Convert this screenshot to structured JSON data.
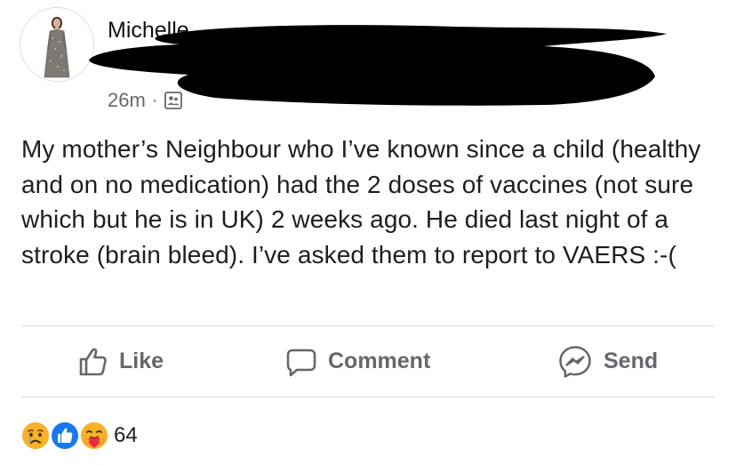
{
  "post": {
    "author_name": "Michelle",
    "timestamp": "26m",
    "separator": "·",
    "audience_icon": "friends-icon",
    "text": "My mother’s Neighbour who I’ve known since a child (healthy and on no medication) had the 2 doses of vaccines (not sure which but he is in UK) 2 weeks ago. He died last night of a stroke (brain bleed). I’ve asked them to report to VAERS :-("
  },
  "actions": {
    "like_label": "Like",
    "comment_label": "Comment",
    "send_label": "Send"
  },
  "reactions": {
    "icons": [
      "sad-reaction-icon",
      "like-reaction-icon",
      "care-reaction-icon"
    ],
    "count": "64"
  },
  "colors": {
    "secondary_text": "#65676b",
    "primary_text": "#1c1e21",
    "like_blue": "#1877f2",
    "reaction_yellow": "#f7b125",
    "care_red": "#f02849",
    "divider": "#d6d9dd"
  }
}
